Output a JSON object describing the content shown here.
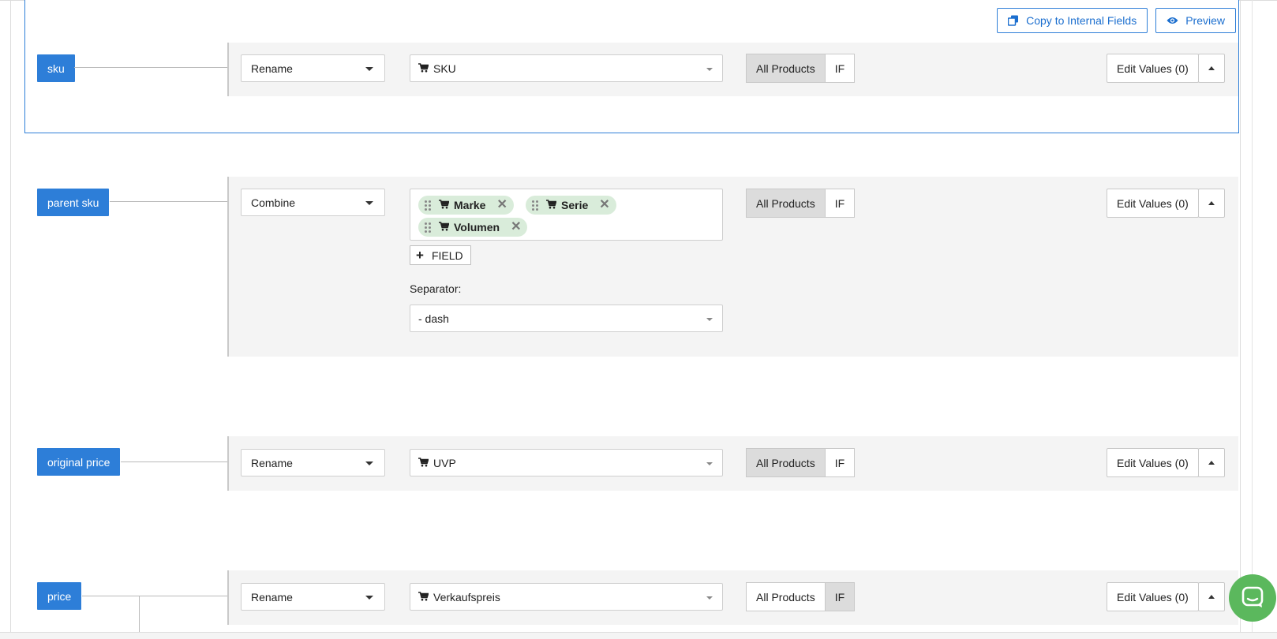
{
  "toolbar": {
    "copy_label": "Copy to Internal Fields",
    "preview_label": "Preview",
    "copy_icon": "copy-icon",
    "preview_icon": "eye-icon"
  },
  "rows": [
    {
      "tag": "sku",
      "operation": "Rename",
      "source_field": "SKU",
      "scope_all": "All Products",
      "scope_if": "IF",
      "active_scope": "all",
      "edit_values": "Edit Values (0)"
    },
    {
      "tag": "parent sku",
      "operation": "Combine",
      "fields": [
        "Marke",
        "Serie",
        "Volumen"
      ],
      "add_field_label": "FIELD",
      "separator_label": "Separator:",
      "separator_value": "- dash",
      "scope_all": "All Products",
      "scope_if": "IF",
      "active_scope": "all",
      "edit_values": "Edit Values (0)"
    },
    {
      "tag": "original price",
      "operation": "Rename",
      "source_field": "UVP",
      "scope_all": "All Products",
      "scope_if": "IF",
      "active_scope": "all",
      "edit_values": "Edit Values (0)"
    },
    {
      "tag": "price",
      "operation": "Rename",
      "source_field": "Verkaufspreis",
      "scope_all": "All Products",
      "scope_if": "IF",
      "active_scope": "if",
      "edit_values": "Edit Values (0)"
    }
  ],
  "colors": {
    "accent": "#2d7ed8",
    "chip": "#d9ecda",
    "chat": "#5bb85d"
  }
}
